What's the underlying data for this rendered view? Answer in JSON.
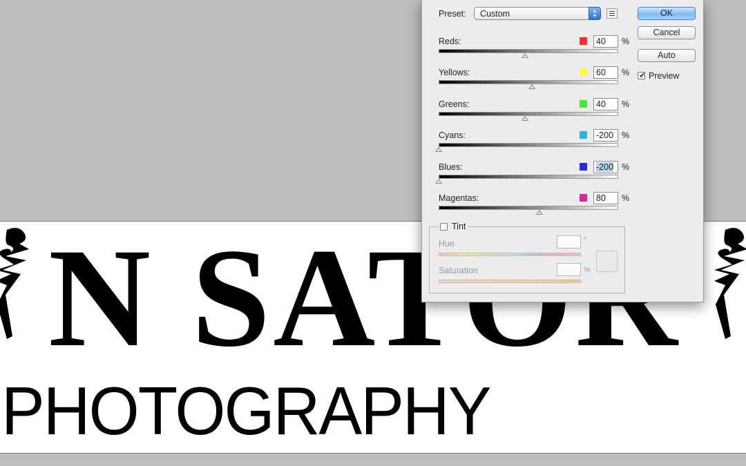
{
  "dialog": {
    "preset_label": "Preset:",
    "preset_value": "Custom",
    "sliders": [
      {
        "label": "Reds:",
        "value": "40",
        "color": "#ff2a2a",
        "level": 40
      },
      {
        "label": "Yellows:",
        "value": "60",
        "color": "#ffff2a",
        "level": 60
      },
      {
        "label": "Greens:",
        "value": "40",
        "color": "#35f035",
        "level": 40
      },
      {
        "label": "Cyans:",
        "value": "-200",
        "color": "#25b4e8",
        "level": -200
      },
      {
        "label": "Blues:",
        "value": "-200",
        "color": "#1f2bf0",
        "level": -200
      },
      {
        "label": "Magentas:",
        "value": "80",
        "color": "#ee1c9a",
        "level": 80
      }
    ],
    "percent_symbol": "%",
    "buttons": {
      "ok": "OK",
      "cancel": "Cancel",
      "auto": "Auto"
    },
    "preview_label": "Preview",
    "preview_checked": true,
    "tint": {
      "label": "Tint",
      "checked": false,
      "hue_label": "Hue",
      "hue_unit": "°",
      "saturation_label": "Saturation",
      "saturation_unit": "%"
    }
  },
  "canvas": {
    "logo_text": "N SATOR",
    "subtitle": "PHOTOGRAPHY"
  }
}
